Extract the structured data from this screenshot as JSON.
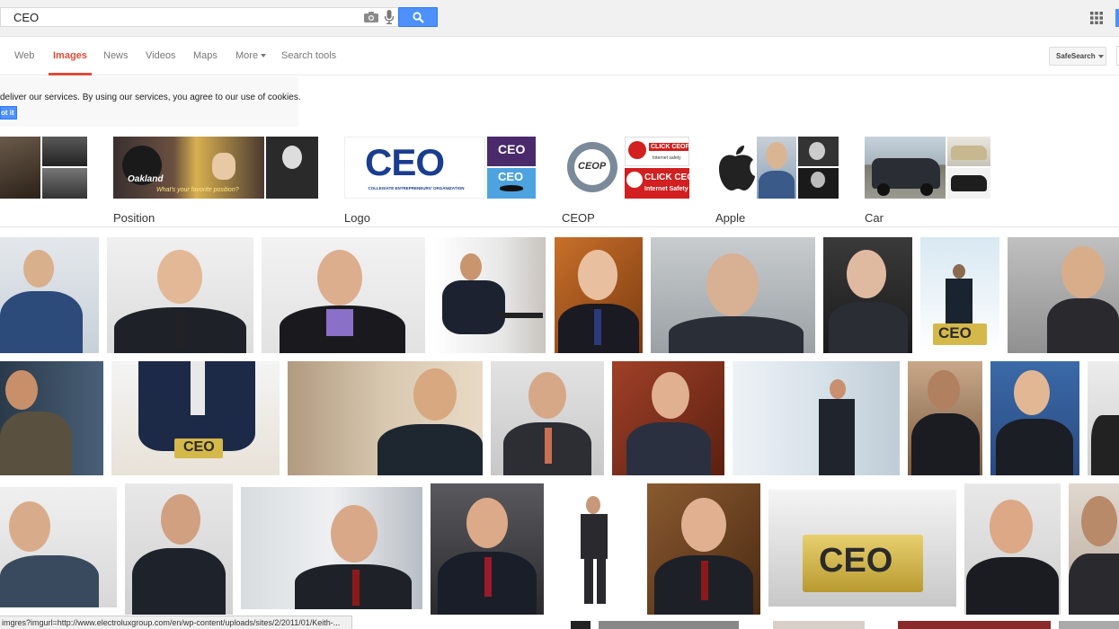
{
  "search": {
    "query": "CEO"
  },
  "icons": {
    "camera": "camera-icon",
    "mic": "microphone-icon",
    "search": "magnifier-icon",
    "apps": "apps-grid-icon"
  },
  "nav": {
    "tabs": [
      {
        "label": "Web"
      },
      {
        "label": "Images"
      },
      {
        "label": "News"
      },
      {
        "label": "Videos"
      },
      {
        "label": "Maps"
      },
      {
        "label": "More"
      },
      {
        "label": "Search tools"
      }
    ],
    "safesearch_label": "SafeSearch"
  },
  "cookie": {
    "text": "deliver our services. By using our services, you agree to our use of cookies.",
    "button": "ot it"
  },
  "related": [
    {
      "label": ""
    },
    {
      "label": "Position"
    },
    {
      "label": "Logo"
    },
    {
      "label": "CEOP"
    },
    {
      "label": "Apple"
    },
    {
      "label": "Car"
    }
  ],
  "thumb_text": {
    "oakland": "Oakland",
    "position_question": "What's your favorite position?",
    "ceo_logo": "CEO",
    "collegiate": "COLLEGIATE ENTREPRENEURS' ORGANIZATION",
    "ceop_small": "CEOP",
    "click_ceop_1": "CLICK CEOP",
    "click_ceop_1_sub": "Internet safety",
    "click_ceop_2": "CLICK CEO",
    "click_ceop_2_sub": "Internet Safety",
    "ceo_sign": "CEO"
  },
  "status_bar": {
    "url": "imgres?imgurl=http://www.electroluxgroup.com/en/wp-content/uploads/sites/2/2011/01/Keith-..."
  },
  "colors": {
    "accent_red": "#dd4b39",
    "search_blue": "#4d90fe"
  }
}
